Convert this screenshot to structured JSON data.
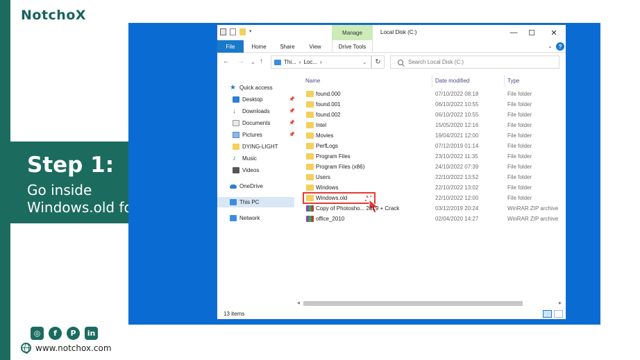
{
  "brand": {
    "logo_text": "NotchoX",
    "accent_color": "#1c6b5f"
  },
  "step": {
    "title": "Step 1:",
    "line1": "Go inside",
    "line2": "Windows.old folder"
  },
  "social": {
    "icons": [
      "instagram-icon",
      "facebook-icon",
      "pinterest-icon",
      "linkedin-icon"
    ],
    "labels": [
      "◎",
      "f",
      "P",
      "in"
    ]
  },
  "website": "www.notchox.com",
  "explorer": {
    "title": "Local Disk (C:)",
    "manage_tab": "Manage",
    "ribbon_tabs": [
      "File",
      "Home",
      "Share",
      "View",
      "Drive Tools"
    ],
    "address": {
      "crumb1": "Thi...",
      "sep": "›",
      "crumb2": "Loc...",
      "arrow": "›"
    },
    "search_placeholder": "Search Local Disk (C:)",
    "nav_pane": [
      {
        "label": "Quick access",
        "icon": "star-icon",
        "pinned": false
      },
      {
        "label": "Desktop",
        "icon": "desktop-icon",
        "pinned": true
      },
      {
        "label": "Downloads",
        "icon": "download-icon",
        "pinned": true
      },
      {
        "label": "Documents",
        "icon": "documents-icon",
        "pinned": true
      },
      {
        "label": "Pictures",
        "icon": "pictures-icon",
        "pinned": true
      },
      {
        "label": "DYING-LIGHT",
        "icon": "folder-icon",
        "pinned": false
      },
      {
        "label": "Music",
        "icon": "music-icon",
        "pinned": false
      },
      {
        "label": "Videos",
        "icon": "videos-icon",
        "pinned": false
      },
      {
        "label": "OneDrive",
        "icon": "cloud-icon",
        "pinned": false
      },
      {
        "label": "This PC",
        "icon": "computer-icon",
        "pinned": false,
        "selected": true
      },
      {
        "label": "Network",
        "icon": "network-icon",
        "pinned": false
      }
    ],
    "columns": {
      "name": "Name",
      "date": "Date modified",
      "type": "Type"
    },
    "files": [
      {
        "name": "found.000",
        "date": "07/10/2022 08:18",
        "type": "File folder",
        "kind": "folder"
      },
      {
        "name": "found.001",
        "date": "06/10/2022 10:55",
        "type": "File folder",
        "kind": "folder"
      },
      {
        "name": "found.002",
        "date": "06/10/2022 10:55",
        "type": "File folder",
        "kind": "folder"
      },
      {
        "name": "Intel",
        "date": "15/05/2020 12:16",
        "type": "File folder",
        "kind": "folder"
      },
      {
        "name": "Movies",
        "date": "19/04/2021 12:00",
        "type": "File folder",
        "kind": "folder"
      },
      {
        "name": "PerfLogs",
        "date": "07/12/2019 01:14",
        "type": "File folder",
        "kind": "folder"
      },
      {
        "name": "Program Files",
        "date": "23/10/2022 11:35",
        "type": "File folder",
        "kind": "folder"
      },
      {
        "name": "Program Files (x86)",
        "date": "24/10/2022 07:39",
        "type": "File folder",
        "kind": "folder"
      },
      {
        "name": "Users",
        "date": "22/10/2022 13:52",
        "type": "File folder",
        "kind": "folder"
      },
      {
        "name": "Windows",
        "date": "22/10/2022 13:02",
        "type": "File folder",
        "kind": "folder"
      },
      {
        "name": "Windows.old",
        "date": "22/10/2022 12:00",
        "type": "File folder",
        "kind": "folder",
        "highlighted": true
      },
      {
        "name": "Copy of Photosho... 2019 + Crack",
        "date": "03/12/2019 20:24",
        "type": "WinRAR ZIP archive",
        "kind": "rar"
      },
      {
        "name": "office_2010",
        "date": "02/04/2020 14:27",
        "type": "WinRAR ZIP archive",
        "kind": "rar"
      }
    ],
    "status": "13 items"
  }
}
